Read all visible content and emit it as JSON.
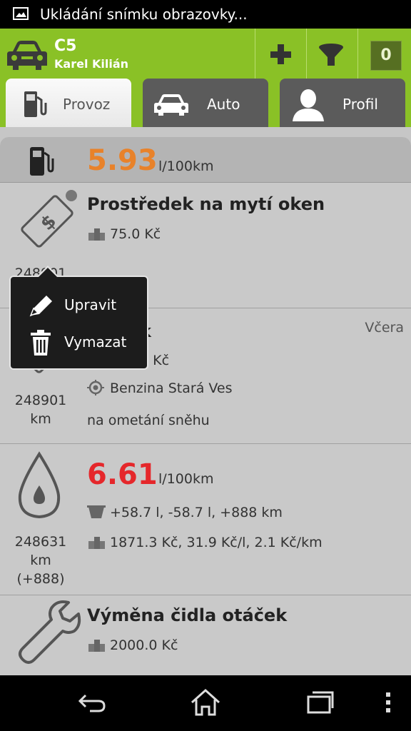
{
  "status_bar": {
    "notification_icon": "image-icon",
    "text": "Ukládání snímku obrazovky..."
  },
  "header": {
    "title": "C5",
    "subtitle": "Karel Kilián",
    "logo_icon": "car-icon",
    "add_icon": "plus-icon",
    "filter_icon": "filter-icon",
    "count": "0",
    "accent_color": "#8ac126"
  },
  "tabs": [
    {
      "label": "Provoz",
      "icon": "fuel-pump-icon",
      "selected": true
    },
    {
      "label": "Auto",
      "icon": "car-icon",
      "selected": false
    },
    {
      "label": "Profil",
      "icon": "person-icon",
      "selected": false
    }
  ],
  "summary": {
    "value": "5.93",
    "unit": "l/100km",
    "value_color": "#e8822a"
  },
  "entries": [
    {
      "icon": "price-tag-icon",
      "title": "Prostředek na mytí oken",
      "cost": "75.0 Kč",
      "odometer": "248901"
    },
    {
      "icon": "price-tag-icon",
      "title": "k",
      "date": "Včera",
      "cost": "0 Kč",
      "location": "Benzina Stará Ves",
      "note": "na ometání sněhu",
      "odometer": "248901",
      "odometer_unit": "km"
    },
    {
      "icon": "fuel-drop-icon",
      "consumption": "6.61",
      "consumption_unit": "l/100km",
      "consumption_color": "#e5272b",
      "fuel": "+58.7 l, -58.7 l, +888 km",
      "cost": "1871.3 Kč, 31.9 Kč/l, 2.1 Kč/km",
      "odometer": "248631",
      "odometer_unit": "km",
      "odometer_delta": "(+888)"
    },
    {
      "icon": "wrench-icon",
      "title": "Výměna čidla otáček",
      "cost": "2000.0 Kč"
    }
  ],
  "context_menu": {
    "items": [
      {
        "label": "Upravit",
        "icon": "pencil-icon"
      },
      {
        "label": "Vymazat",
        "icon": "trash-icon"
      }
    ]
  },
  "navbar": {
    "back_icon": "back-icon",
    "home_icon": "home-icon",
    "recents_icon": "recents-icon",
    "menu_icon": "overflow-menu-icon"
  }
}
